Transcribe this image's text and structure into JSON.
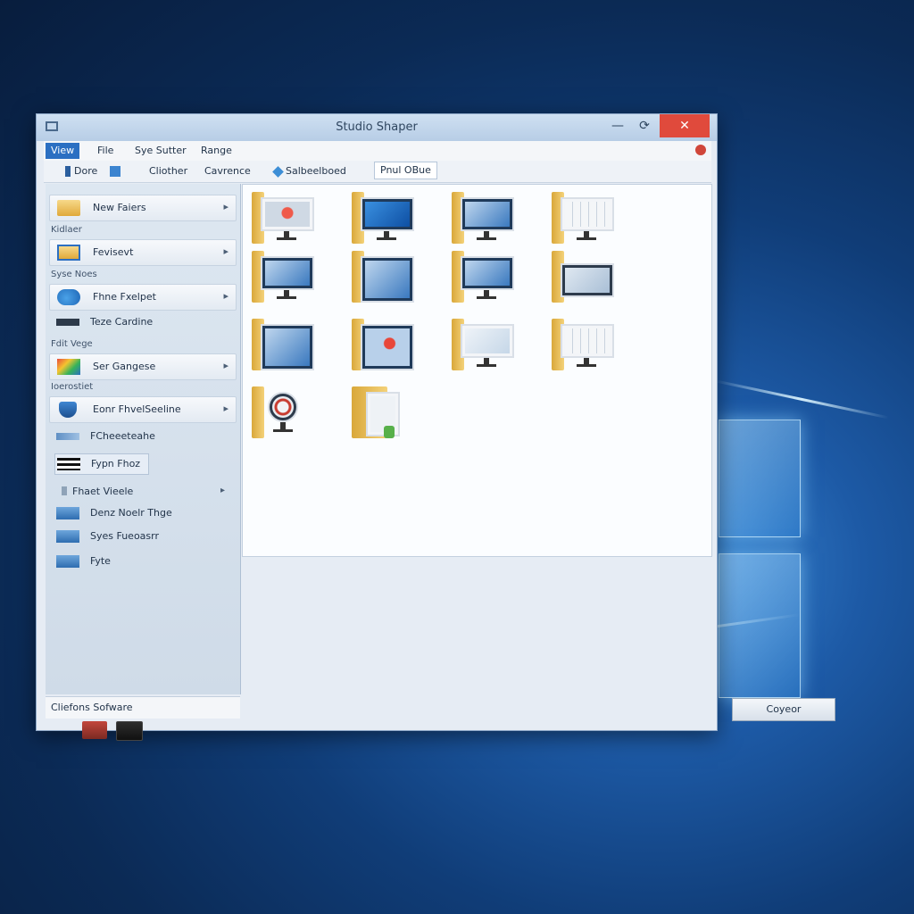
{
  "window": {
    "title": "Studio Shaper",
    "min_icon": "minimize-icon",
    "restore_icon": "restore-icon",
    "close_icon": "close-icon"
  },
  "menu": {
    "items": [
      "View",
      "File",
      "Sye Sutter",
      "Range"
    ]
  },
  "toolbar": {
    "items": [
      "Dore",
      "Cliother",
      "Cavrence",
      "Salbeelboed",
      "Pnul OBue"
    ]
  },
  "sidebar": {
    "groups": [
      {
        "label": "New Faiers",
        "icon": "folder-icon"
      },
      {
        "label": "Fevisevt",
        "icon": "folder-icon"
      },
      {
        "label": "Fhne Fxelpet",
        "icon": "cloud-icon"
      },
      {
        "label": "Ser Gangese",
        "icon": "palette-icon"
      },
      {
        "label": "Eonr FhvelSeeline",
        "icon": "shield-icon"
      }
    ],
    "categories": [
      "Kidlaer",
      "Syse Noes",
      "Fdit Vege",
      "Ioerostiet"
    ],
    "items": [
      {
        "label": "Teze Cardine",
        "icon": "keyboard-icon"
      },
      {
        "label": "FCheeeteahe",
        "icon": "pen-icon"
      },
      {
        "label": "Fypn Fhoz",
        "icon": "bars-icon"
      },
      {
        "label": "Fhaet Vieele",
        "icon": "gear-icon"
      },
      {
        "label": "Denz Noelr Thge",
        "icon": "monitor-icon"
      },
      {
        "label": "Syes Fueoasrr",
        "icon": "monitor-icon"
      },
      {
        "label": "Fyte",
        "icon": "monitor-icon"
      }
    ],
    "status": "Cliefons Sofware"
  },
  "popup": {
    "label": "Coyeor"
  },
  "colors": {
    "accent": "#2b6fc2",
    "close": "#e04a3c",
    "folder": "#f4d27a"
  }
}
